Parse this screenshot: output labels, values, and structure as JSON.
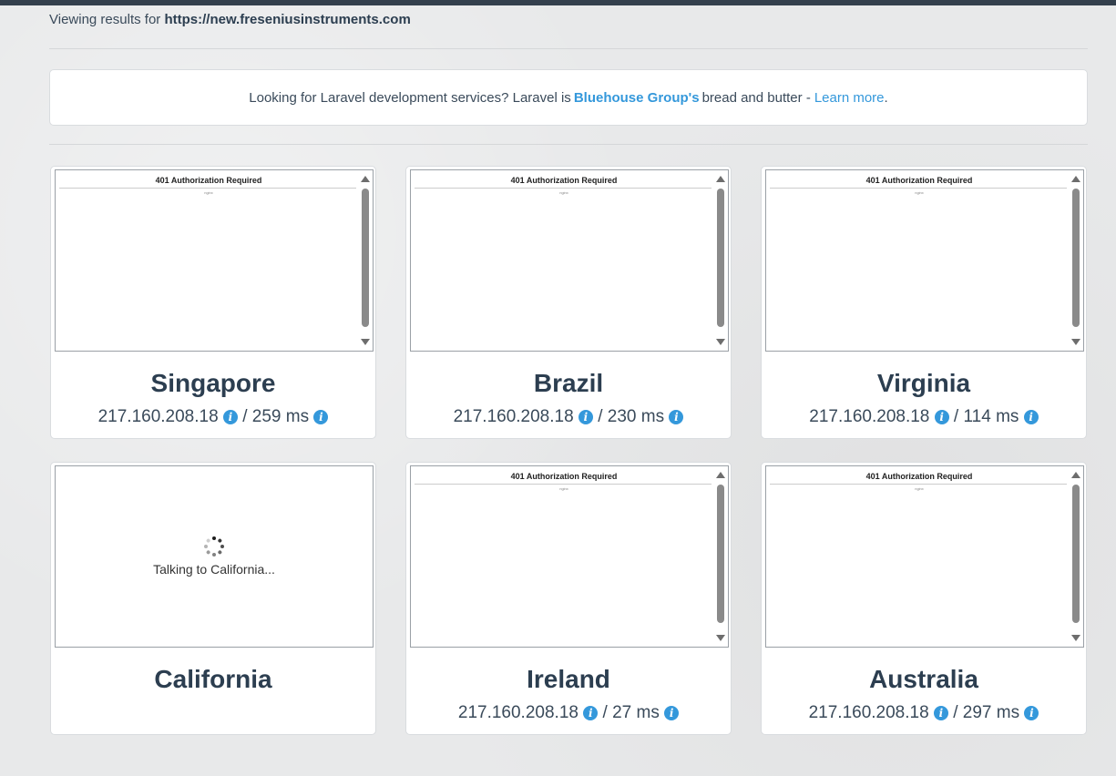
{
  "header": {
    "viewing_prefix": "Viewing results for",
    "url": "https://new.freseniusinstruments.com"
  },
  "promo": {
    "before": "Looking for Laravel development services? Laravel is",
    "brand": "Bluehouse Group's",
    "middle": "bread and butter -",
    "link": "Learn more",
    "after": "."
  },
  "frame_title": "401 Authorization Required",
  "frame_small": "nginx",
  "results": [
    {
      "city": "Singapore",
      "ip": "217.160.208.18",
      "ms": "259 ms",
      "loaded": true
    },
    {
      "city": "Brazil",
      "ip": "217.160.208.18",
      "ms": "230 ms",
      "loaded": true
    },
    {
      "city": "Virginia",
      "ip": "217.160.208.18",
      "ms": "114 ms",
      "loaded": true
    },
    {
      "city": "California",
      "loaded": false,
      "loading_text": "Talking to California..."
    },
    {
      "city": "Ireland",
      "ip": "217.160.208.18",
      "ms": "27 ms",
      "loaded": true
    },
    {
      "city": "Australia",
      "ip": "217.160.208.18",
      "ms": "297 ms",
      "loaded": true
    }
  ],
  "icons": {
    "info": "info-circle-icon",
    "spinner": "spinner-icon"
  },
  "colors": {
    "accent": "#3498db",
    "heading": "#2c3e50",
    "topbar": "#34404d"
  }
}
